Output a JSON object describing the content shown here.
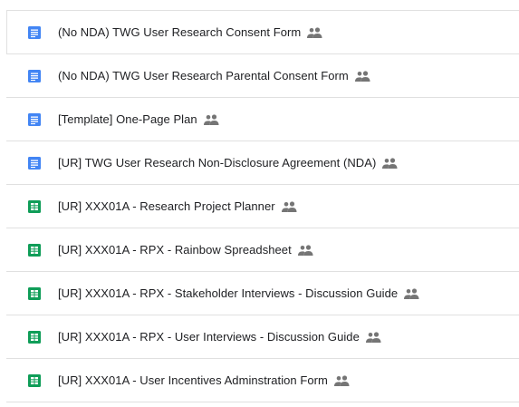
{
  "colors": {
    "docs": "#4285f4",
    "sheets": "#0f9d58",
    "shared_icon": "#757575"
  },
  "files": [
    {
      "name": "(No NDA) TWG User Research Consent Form",
      "type": "docs",
      "icon": "google-docs-icon",
      "shared": true
    },
    {
      "name": "(No NDA) TWG User Research Parental Consent Form",
      "type": "docs",
      "icon": "google-docs-icon",
      "shared": true
    },
    {
      "name": "[Template] One-Page Plan",
      "type": "docs",
      "icon": "google-docs-icon",
      "shared": true
    },
    {
      "name": "[UR] TWG User Research Non-Disclosure Agreement (NDA)",
      "type": "docs",
      "icon": "google-docs-icon",
      "shared": true
    },
    {
      "name": "[UR] XXX01A - Research Project Planner",
      "type": "sheets",
      "icon": "google-sheets-icon",
      "shared": true
    },
    {
      "name": "[UR] XXX01A - RPX - Rainbow Spreadsheet",
      "type": "sheets",
      "icon": "google-sheets-icon",
      "shared": true
    },
    {
      "name": "[UR] XXX01A - RPX - Stakeholder Interviews - Discussion Guide",
      "type": "sheets",
      "icon": "google-sheets-icon",
      "shared": true
    },
    {
      "name": "[UR] XXX01A - RPX - User Interviews - Discussion Guide",
      "type": "sheets",
      "icon": "google-sheets-icon",
      "shared": true
    },
    {
      "name": "[UR] XXX01A - User Incentives Adminstration Form",
      "type": "sheets",
      "icon": "google-sheets-icon",
      "shared": true
    }
  ]
}
